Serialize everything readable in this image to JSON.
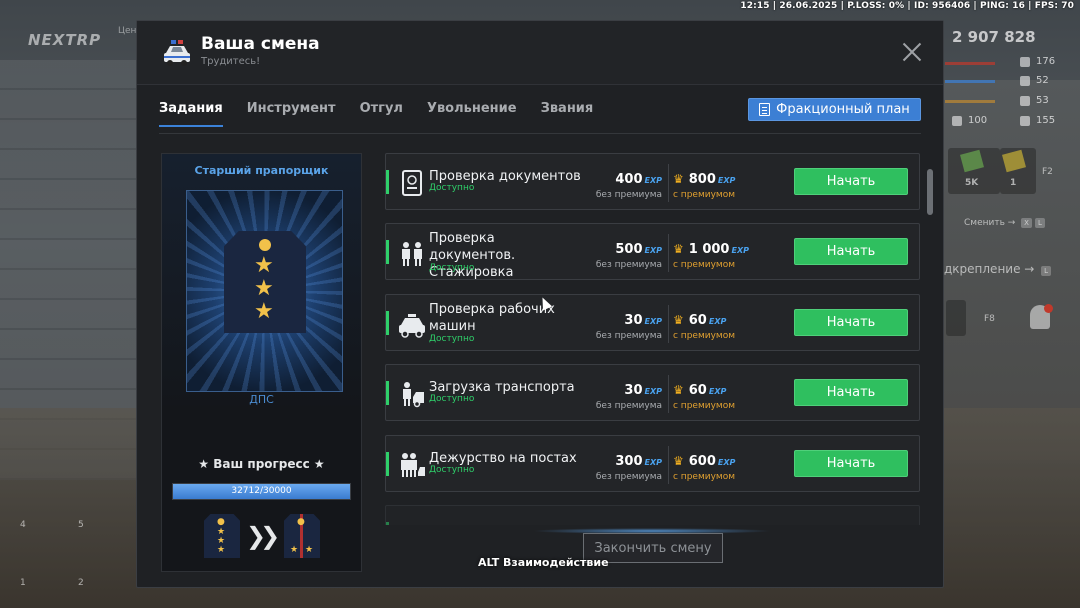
{
  "statusbar": "12:15 | 26.06.2025 | P.LOSS: 0% | ID: 956406 | PING: 16 | FPS: 70",
  "hud": {
    "logo": "NEXTRP",
    "logo_sub": "Цен",
    "money": "2 907 828",
    "stats": [
      "176",
      "52",
      "53",
      "155"
    ],
    "stat_100": "100",
    "slot_5k": "5K",
    "slot_1": "1",
    "slot_f2": "F2",
    "change_label": "Сменить",
    "reinforce_label": "дкрепление",
    "key_x": "X",
    "key_l": "L",
    "key_f8": "F8",
    "slot_4": "4",
    "slot_5": "5",
    "slot_1b": "1",
    "slot_2": "2"
  },
  "modal": {
    "title": "Ваша смена",
    "subtitle": "Трудитесь!",
    "tabs": [
      {
        "label": "Задания",
        "active": true
      },
      {
        "label": "Инструмент",
        "active": false
      },
      {
        "label": "Отгул",
        "active": false
      },
      {
        "label": "Увольнение",
        "active": false
      },
      {
        "label": "Звания",
        "active": false
      }
    ],
    "faction_plan_label": "Фракционный план",
    "end_shift_label": "Закончить смену"
  },
  "rank": {
    "name": "Старший прапорщик",
    "faction": "ДПС",
    "progress_label": "★ Ваш прогресс ★",
    "progress_text": "32712/30000",
    "progress_fraction": 1.0
  },
  "reward_labels": {
    "no_premium": "без премиума",
    "with_premium": "с премиумом",
    "exp": "EXP",
    "start": "Начать"
  },
  "tasks": [
    {
      "name": "Проверка документов",
      "status": "Доступно",
      "base": "400",
      "premium": "800"
    },
    {
      "name": "Проверка документов. Стажировка",
      "status": "Доступно",
      "base": "500",
      "premium": "1 000"
    },
    {
      "name": "Проверка рабочих машин",
      "status": "Доступно",
      "base": "30",
      "premium": "60"
    },
    {
      "name": "Загрузка транспорта",
      "status": "Доступно",
      "base": "30",
      "premium": "60"
    },
    {
      "name": "Дежурство на постах",
      "status": "Доступно",
      "base": "300",
      "premium": "600"
    }
  ],
  "alt_hint": "ALT Взаимодействие",
  "colors": {
    "accent_blue": "#3c7fd4",
    "start_green": "#2fbf5f",
    "available_green": "#2fcf6a",
    "premium_gold": "#e0a030"
  }
}
